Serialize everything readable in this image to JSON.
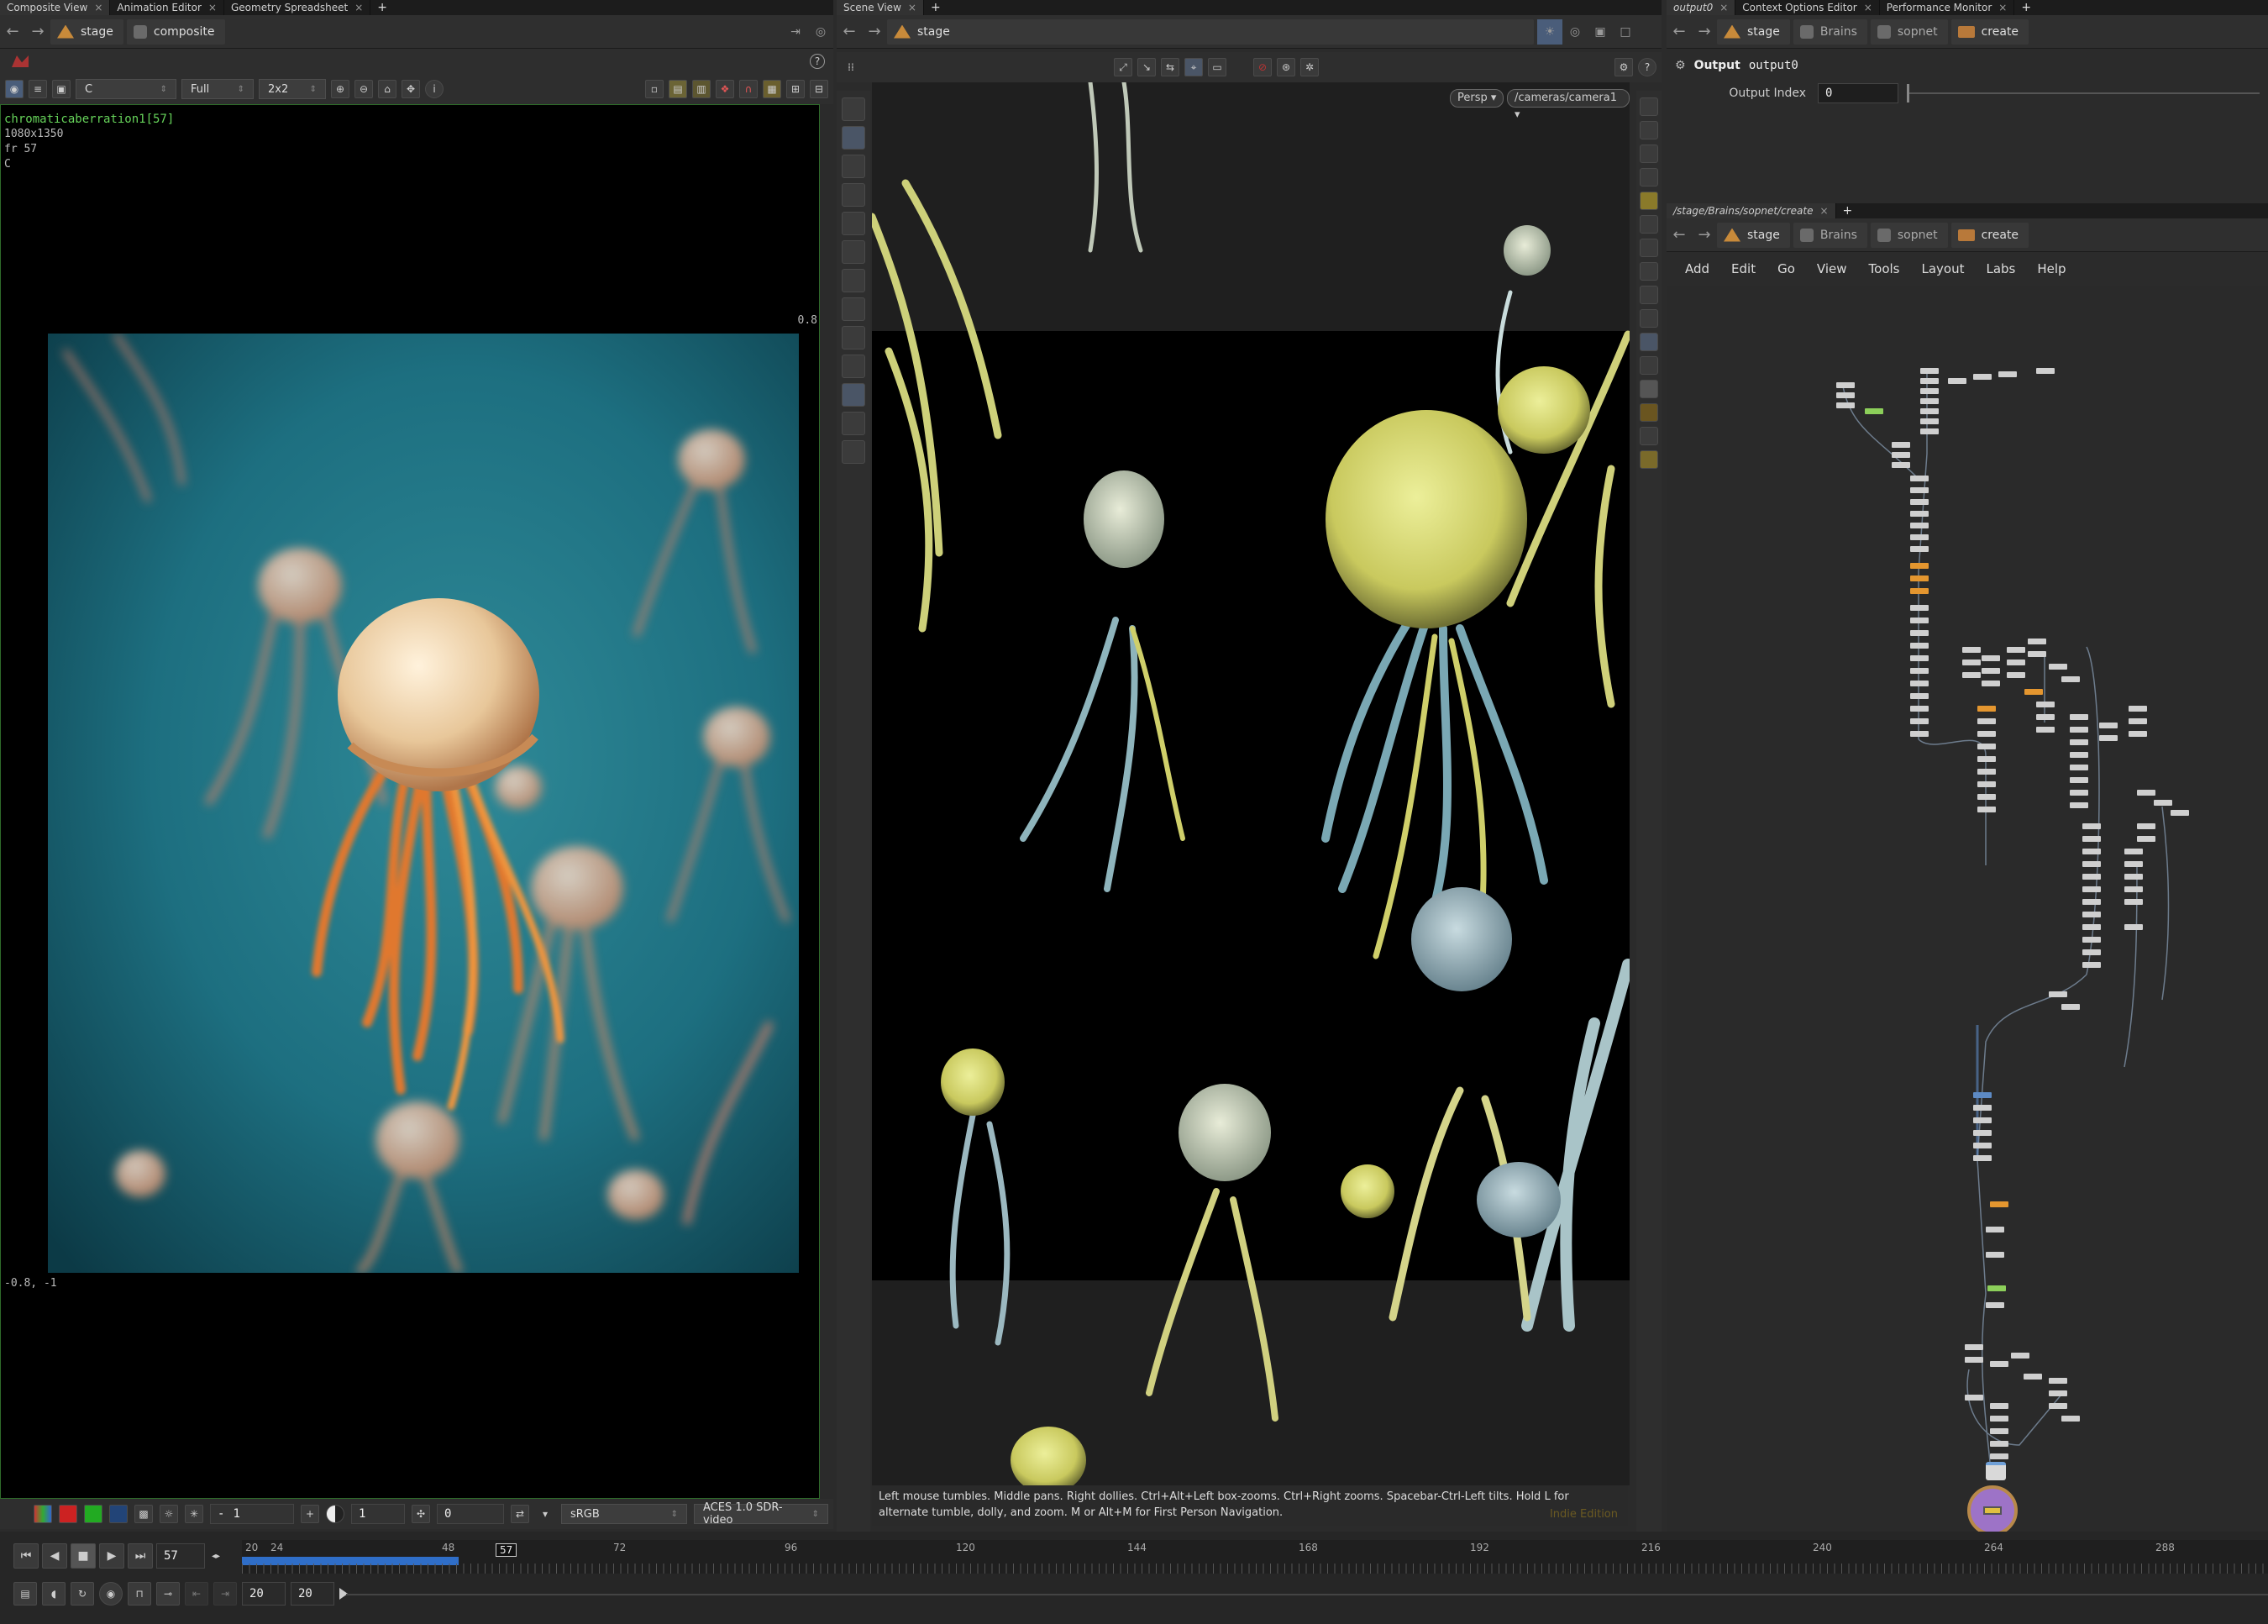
{
  "composite": {
    "tabs": [
      "Composite View",
      "Animation Editor",
      "Geometry Spreadsheet"
    ],
    "crumbs": [
      "stage",
      "composite"
    ],
    "toolbar": {
      "channel": "C",
      "res": "Full",
      "grid": "2x2"
    },
    "overlay": {
      "node": "chromaticaberration1[57]",
      "res": "1080x1350",
      "frame": "fr 57",
      "chan": "C"
    },
    "corner_top": "0.8",
    "corner_bottom": "-0.8, -1",
    "bottom": {
      "val1": "1",
      "val2": "1",
      "val3": "0",
      "colorspace": "sRGB",
      "display": "ACES 1.0 SDR-video"
    }
  },
  "scene": {
    "tabs": [
      "Scene View"
    ],
    "crumbs": [
      "stage"
    ],
    "persp": "Persp",
    "camera": "/cameras/camera1",
    "status": "Left mouse tumbles. Middle pans. Right dollies. Ctrl+Alt+Left box-zooms. Ctrl+Right zooms. Spacebar-Ctrl-Left tilts. Hold L for alternate tumble, dolly, and zoom. M or Alt+M for First Person Navigation.",
    "edition": "Indie Edition"
  },
  "params": {
    "tabs": [
      "output0",
      "Context Options Editor",
      "Performance Monitor"
    ],
    "crumbs": [
      "stage",
      "Brains",
      "sopnet",
      "create"
    ],
    "node_type": "Output",
    "node_name": "output0",
    "output_index_label": "Output Index",
    "output_index_value": "0"
  },
  "network": {
    "tabs": [
      "/stage/Brains/sopnet/create"
    ],
    "crumbs": [
      "stage",
      "Brains",
      "sopnet",
      "create"
    ],
    "menu": [
      "Add",
      "Edit",
      "Go",
      "View",
      "Tools",
      "Layout",
      "Labs",
      "Help"
    ]
  },
  "timeline": {
    "current_frame": "57",
    "marker": "57",
    "ticks": [
      "20",
      "24",
      "48",
      "72",
      "96",
      "120",
      "144",
      "168",
      "192",
      "216",
      "240",
      "264",
      "288"
    ],
    "start": "20",
    "end": "20"
  },
  "colors": {
    "accent_green": "#3e8a3a",
    "range_blue": "#2f6ec8",
    "node_orange": "#e4962f"
  }
}
